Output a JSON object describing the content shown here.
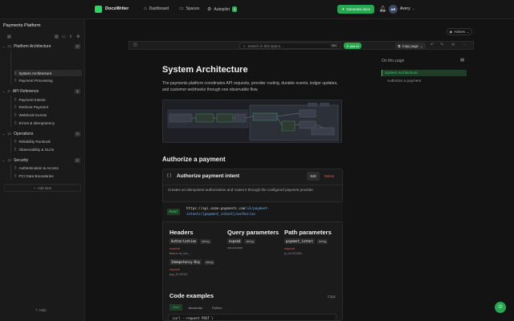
{
  "app": {
    "name": "DocsWriter"
  },
  "topnav": {
    "dashboard": "Dashboard",
    "spaces": "Spaces",
    "autopilot": "Autopilot",
    "autopilot_badge": "3",
    "generate": "Generate docs",
    "avatar": "AR",
    "user": "Avery"
  },
  "sidebar": {
    "title": "Payments Platform",
    "groups": [
      {
        "label": "Platform Architecture",
        "count": "2",
        "items": [
          "System Architecture",
          "Payment Processing"
        ]
      },
      {
        "label": "API Reference",
        "count": "4",
        "items": [
          "Payment Intents",
          "Retrieve Payment",
          "Webhook Events",
          "Errors & Idempotency"
        ]
      },
      {
        "label": "Operations",
        "count": "2",
        "items": [
          "Reliability Runbook",
          "Observability & SLOs"
        ]
      },
      {
        "label": "Security",
        "count": "2",
        "items": [
          "Authentication & Access",
          "PCI Data Boundaries"
        ]
      }
    ],
    "add_item": "Add item",
    "help": "Help"
  },
  "editor": {
    "actives": "Actives",
    "search_placeholder": "Search in this space...",
    "search_kbd": "⌘K",
    "ask_ai": "Ask AI",
    "copy_page": "Copy page"
  },
  "doc": {
    "title": "System Architecture",
    "intro": "The payments platform coordinates API requests, provider routing, durable events, ledger updates, and customer webhooks through one observable flow.",
    "section_title": "Authorize a payment",
    "endpoint": {
      "title": "Authorize payment intent",
      "edit": "Edit",
      "delete": "Delete",
      "description": "Creates an idempotent authorization and routes it through the configured payment provider.",
      "method": "POST",
      "url_start": "https://api.acme-payments.com",
      "url_version": "/v1/payment-",
      "url_rest": "intents/{payment_intent}/authorize",
      "headers_title": "Headers",
      "query_title": "Query parameters",
      "path_title": "Path parameters",
      "headers": [
        {
          "name": "Authorization",
          "type": "string",
          "required": "required",
          "example": "Bearer sk_live_..."
        },
        {
          "name": "Idempotency-Key",
          "type": "string",
          "required": "required",
          "example": "pay_01J9Y6Z..."
        }
      ],
      "query": [
        {
          "name": "expand",
          "type": "string",
          "example": "risk,provider"
        }
      ],
      "path": [
        {
          "name": "payment_intent",
          "type": "string",
          "required": "required",
          "example": "pi_01J9Y2K8..."
        }
      ],
      "code_title": "Code examples",
      "copy": "Copy",
      "code_tabs": [
        "Curl",
        "Javascript",
        "Python"
      ],
      "code_line": "curl --request POST \\"
    }
  },
  "toc": {
    "title": "On this page",
    "items": [
      "System Architecture",
      "Authorize a payment"
    ]
  },
  "colors": {
    "accent": "#2bd463",
    "bg": "#131313",
    "panel": "#1b1b1b",
    "danger": "#e05a5a"
  }
}
